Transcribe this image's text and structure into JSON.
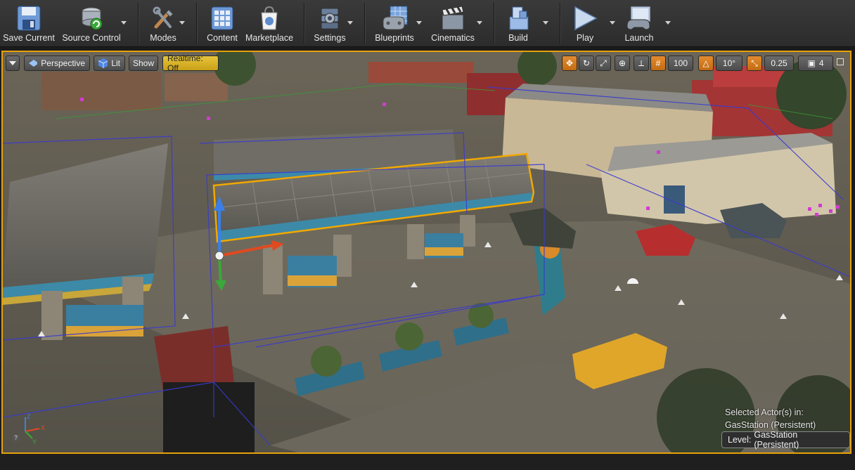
{
  "toolbar": {
    "items": [
      {
        "label": "Save Current",
        "icon": "save-icon"
      },
      {
        "label": "Source Control",
        "icon": "source-control-icon"
      },
      {
        "label": "Modes",
        "icon": "modes-icon"
      },
      {
        "label": "Content",
        "icon": "content-icon"
      },
      {
        "label": "Marketplace",
        "icon": "marketplace-icon"
      },
      {
        "label": "Settings",
        "icon": "settings-icon"
      },
      {
        "label": "Blueprints",
        "icon": "blueprints-icon"
      },
      {
        "label": "Cinematics",
        "icon": "cinematics-icon"
      },
      {
        "label": "Build",
        "icon": "build-icon"
      },
      {
        "label": "Play",
        "icon": "play-icon"
      },
      {
        "label": "Launch",
        "icon": "launch-icon"
      }
    ]
  },
  "viewport": {
    "perspective_label": "Perspective",
    "lit_label": "Lit",
    "show_label": "Show",
    "realtime_label": "Realtime: Off",
    "grid_snap_value": "100",
    "rotation_snap_value": "10°",
    "scale_snap_value": "0.25",
    "camera_speed_value": "4",
    "selected_actors_line1": "Selected Actor(s) in:",
    "selected_actors_line2": "GasStation (Persistent)",
    "level_key": "Level:",
    "level_value": "GasStation (Persistent)",
    "axis_labels": {
      "z": "Z",
      "x": "X",
      "y": "Y"
    }
  },
  "colors": {
    "accent": "#e8a10a",
    "realtime": "#d9b22a",
    "selection": "#f0a800",
    "bounds": "#3a3ad0"
  }
}
